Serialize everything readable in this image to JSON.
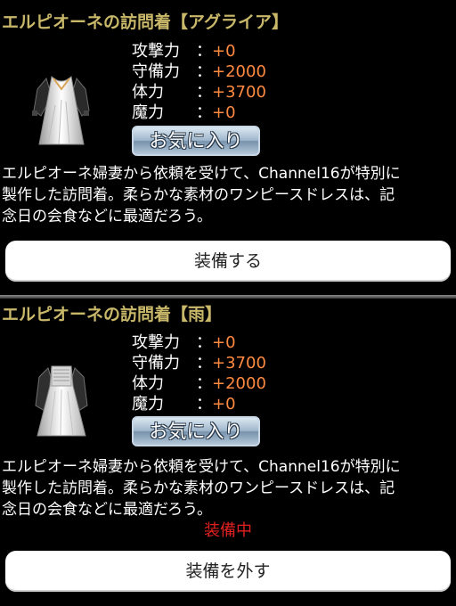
{
  "items": [
    {
      "title": "エルピオーネの訪問着【アグライア】",
      "icon": "dress-icon",
      "stats": [
        {
          "label": "攻撃力",
          "colon": "：",
          "value": "+0"
        },
        {
          "label": "守備力",
          "colon": "：",
          "value": "+2000"
        },
        {
          "label": "体力",
          "colon": "：",
          "value": "+3700"
        },
        {
          "label": "魔力",
          "colon": "：",
          "value": "+0"
        }
      ],
      "favorite_label": "お気に入り",
      "description": [
        "エルピオーネ婦妻から依頼を受けて、Channel16が特別に",
        "製作した訪問着。柔らかな素材のワンピースドレスは、記",
        "念日の会食などに最適だろう。"
      ],
      "action_label": "装備する"
    },
    {
      "title": "エルピオーネの訪問着【雨】",
      "icon": "dress-icon",
      "stats": [
        {
          "label": "攻撃力",
          "colon": "：",
          "value": "+0"
        },
        {
          "label": "守備力",
          "colon": "：",
          "value": "+3700"
        },
        {
          "label": "体力",
          "colon": "：",
          "value": "+2000"
        },
        {
          "label": "魔力",
          "colon": "：",
          "value": "+0"
        }
      ],
      "favorite_label": "お気に入り",
      "description": [
        "エルピオーネ婦妻から依頼を受けて、Channel16が特別に",
        "製作した訪問着。柔らかな素材のワンピースドレスは、記",
        "念日の会食などに最適だろう。"
      ],
      "equipped_label": "装備中",
      "action_label": "装備を外す"
    }
  ],
  "colors": {
    "title": "#c9b86a",
    "stat_value": "#ff8a40",
    "equipped": "#e02020"
  }
}
